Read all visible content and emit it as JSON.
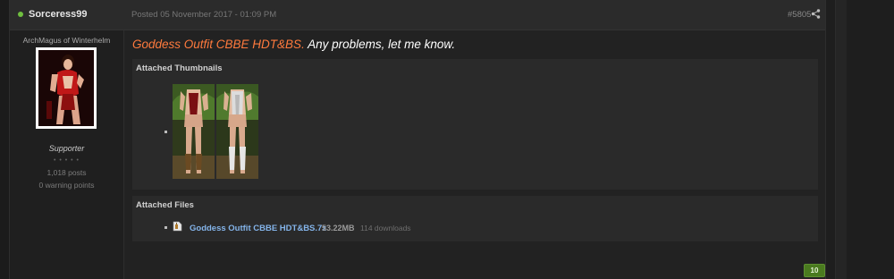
{
  "post": {
    "author": "Sorceress99",
    "date": "Posted 05 November 2017 - 01:09 PM",
    "number": "#5805",
    "author_title": "ArchMagus of Winterhelm",
    "group": "Supporter",
    "pips": "• • • • •",
    "post_count": "1,018 posts",
    "warning_points": "0 warning points",
    "body_highlight": "Goddess Outfit CBBE HDT&BS.",
    "body_rest": " Any problems, let me know.",
    "reputation": "10"
  },
  "attachments": {
    "thumbnails_title": "Attached Thumbnails",
    "files_title": "Attached Files",
    "files": [
      {
        "name": "Goddess Outfit CBBE HDT&BS.7z",
        "size": "53.22MB",
        "downloads": "114 downloads"
      }
    ]
  },
  "colors": {
    "online": "#6fbf3f",
    "highlight": "#ff7a3d",
    "link": "#84b4ea",
    "reputation": "#4a7a1f"
  },
  "icons": {
    "online": "online-dot-icon",
    "share": "share-icon",
    "file": "archive-file-icon"
  }
}
